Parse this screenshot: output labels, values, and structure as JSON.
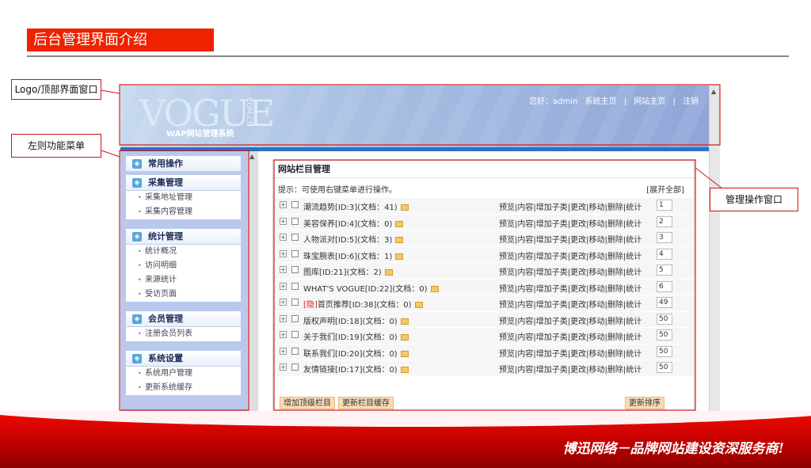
{
  "slide": {
    "title": "后台管理界面介绍",
    "callouts": {
      "logo": "Logo/顶部界面窗口",
      "menu": "左则功能菜单",
      "manage": "管理操作窗口"
    },
    "footer_slogan": "博迅网络－品牌网站建设资深服务商!",
    "accent_color": "#ee2200"
  },
  "header": {
    "logo_text": "VOGUE",
    "logo_com": "COM.CN",
    "logo_sub": "WAP网站管理系统",
    "greeting": "您好：admin",
    "links": [
      "系统主页",
      "网站主页",
      "注销"
    ]
  },
  "sidebar": {
    "sections": [
      {
        "label": "常用操作",
        "items": []
      },
      {
        "label": "采集管理",
        "items": [
          "采集地址管理",
          "采集内容管理"
        ]
      },
      {
        "label": "统计管理",
        "items": [
          "统计概况",
          "访问明细",
          "来源统计",
          "受访页面"
        ]
      },
      {
        "label": "会员管理",
        "items": [
          "注册会员列表"
        ]
      },
      {
        "label": "系统设置",
        "items": [
          "系统用户管理",
          "更新系统缓存"
        ]
      }
    ]
  },
  "main": {
    "title": "网站栏目管理",
    "hint": "提示：可使用右键菜单进行操作。",
    "expand_all": "[展开全部]",
    "actions": "预览|内容|增加子类|更改|移动|删除|统计",
    "rows": [
      {
        "hidden_tag": "",
        "name": "潮流趋势[ID:3](文档：41)",
        "order": "1"
      },
      {
        "hidden_tag": "",
        "name": "美容保养[ID:4](文档：0)",
        "order": "2"
      },
      {
        "hidden_tag": "",
        "name": "人物派对[ID:5](文档：3)",
        "order": "3"
      },
      {
        "hidden_tag": "",
        "name": "珠宝腕表[ID:6](文档：1)",
        "order": "4"
      },
      {
        "hidden_tag": "",
        "name": "图库[ID:21](文档：2)",
        "order": "5"
      },
      {
        "hidden_tag": "",
        "name": "WHAT'S VOGUE[ID:22](文档：0)",
        "order": "6"
      },
      {
        "hidden_tag": "[隐]",
        "name": "首页推荐[ID:38](文档：0)",
        "order": "49"
      },
      {
        "hidden_tag": "",
        "name": "版权声明[ID:18](文档：0)",
        "order": "50"
      },
      {
        "hidden_tag": "",
        "name": "关于我们[ID:19](文档：0)",
        "order": "50"
      },
      {
        "hidden_tag": "",
        "name": "联系我们[ID:20](文档：0)",
        "order": "50"
      },
      {
        "hidden_tag": "",
        "name": "友情链接[ID:17](文档：0)",
        "order": "50"
      }
    ],
    "buttons": {
      "add_top": "增加顶级栏目",
      "update_cache": "更新栏目缓存",
      "update_order": "更新排序"
    }
  }
}
